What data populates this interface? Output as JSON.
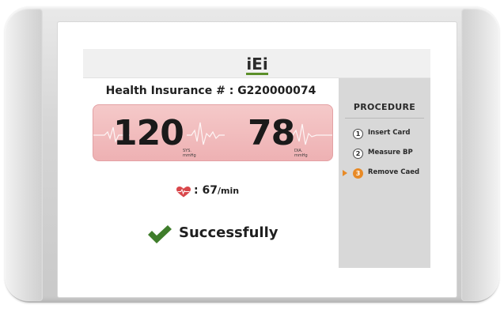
{
  "app": {
    "logo_text": "iEi",
    "brand_color": "#5b8f2a"
  },
  "patient": {
    "health_insurance_label": "Health Insurance #",
    "separator": ":",
    "health_insurance_number": "G220000074"
  },
  "blood_pressure": {
    "systolic_value": "120",
    "systolic_label": "SYS.",
    "systolic_unit": "mmHg",
    "diastolic_value": "78",
    "diastolic_label": "DIA.",
    "diastolic_unit": "mmHg",
    "card_color": "#f0b9bb"
  },
  "pulse": {
    "separator": ":",
    "value": "67",
    "unit": "/min",
    "icon": "heart-pulse-icon",
    "icon_color": "#d9474b"
  },
  "status": {
    "text": "Successfully",
    "icon": "check-icon",
    "icon_color": "#3f7d2b"
  },
  "procedure": {
    "title": "PROCEDURE",
    "steps": [
      {
        "number": "1",
        "label": "Insert Card",
        "active": false
      },
      {
        "number": "2",
        "label": "Measure BP",
        "active": false
      },
      {
        "number": "3",
        "label": "Remove Caed",
        "active": true
      }
    ],
    "active_color": "#e88a26"
  }
}
